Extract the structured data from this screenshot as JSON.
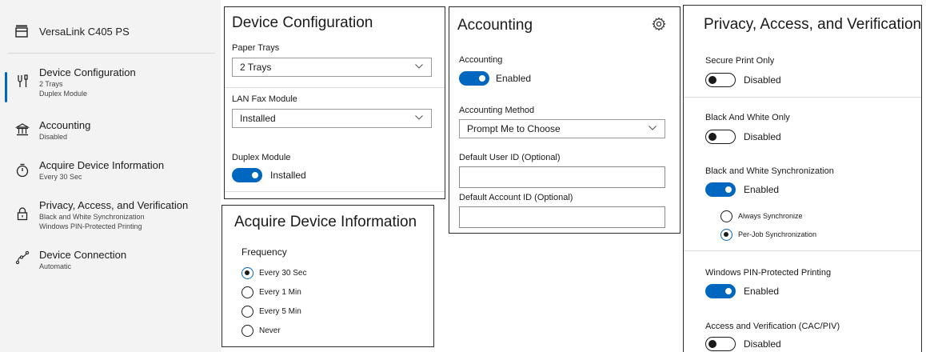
{
  "nav": {
    "header": {
      "label": "VersaLink C405 PS",
      "icon": "printer-icon"
    },
    "items": [
      {
        "title": "Device Configuration",
        "subs": [
          "2 Trays",
          "Duplex Module"
        ],
        "icon": "wrench-screwdriver-icon"
      },
      {
        "title": "Accounting",
        "subs": [
          "Disabled"
        ],
        "icon": "bank-icon"
      },
      {
        "title": "Acquire Device Information",
        "subs": [
          "Every 30 Sec"
        ],
        "icon": "timer-icon"
      },
      {
        "title": "Privacy, Access, and Verification",
        "subs": [
          "Black and White Synchronization",
          "Windows PIN-Protected Printing"
        ],
        "icon": "lock-icon"
      },
      {
        "title": "Device Connection",
        "subs": [
          "Automatic"
        ],
        "icon": "connection-icon"
      }
    ]
  },
  "device_config": {
    "title": "Device Configuration",
    "paper_trays_label": "Paper Trays",
    "paper_trays_value": "2 Trays",
    "lan_fax_label": "LAN Fax Module",
    "lan_fax_value": "Installed",
    "duplex_label": "Duplex Module",
    "duplex_state": "Installed",
    "duplex_on": true
  },
  "acquire": {
    "title": "Acquire Device Information",
    "frequency_label": "Frequency",
    "options": [
      "Every 30 Sec",
      "Every 1 Min",
      "Every 5 Min",
      "Never"
    ],
    "selected": "Every 30 Sec"
  },
  "accounting": {
    "title": "Accounting",
    "settings_icon": "gear-icon",
    "accounting_label": "Accounting",
    "accounting_state": "Enabled",
    "accounting_on": true,
    "method_label": "Accounting Method",
    "method_value": "Prompt Me to Choose",
    "user_id_label": "Default User ID (Optional)",
    "user_id_value": "",
    "account_id_label": "Default Account ID (Optional)",
    "account_id_value": ""
  },
  "privacy": {
    "title": "Privacy, Access, and Verification",
    "secure_print_label": "Secure Print Only",
    "secure_print_state": "Disabled",
    "bw_only_label": "Black And White Only",
    "bw_only_state": "Disabled",
    "bw_sync_label": "Black and White Synchronization",
    "bw_sync_state": "Enabled",
    "sync_options": [
      "Always Synchronize",
      "Per-Job Synchronization"
    ],
    "sync_selected": "Per-Job Synchronization",
    "pin_label": "Windows PIN-Protected Printing",
    "pin_state": "Enabled",
    "cac_label": "Access and Verification (CAC/PIV)",
    "cac_state": "Disabled"
  },
  "colors": {
    "accent": "#0067c0",
    "nav_bg": "#f3f3f3",
    "border": "#2b2b2b"
  }
}
